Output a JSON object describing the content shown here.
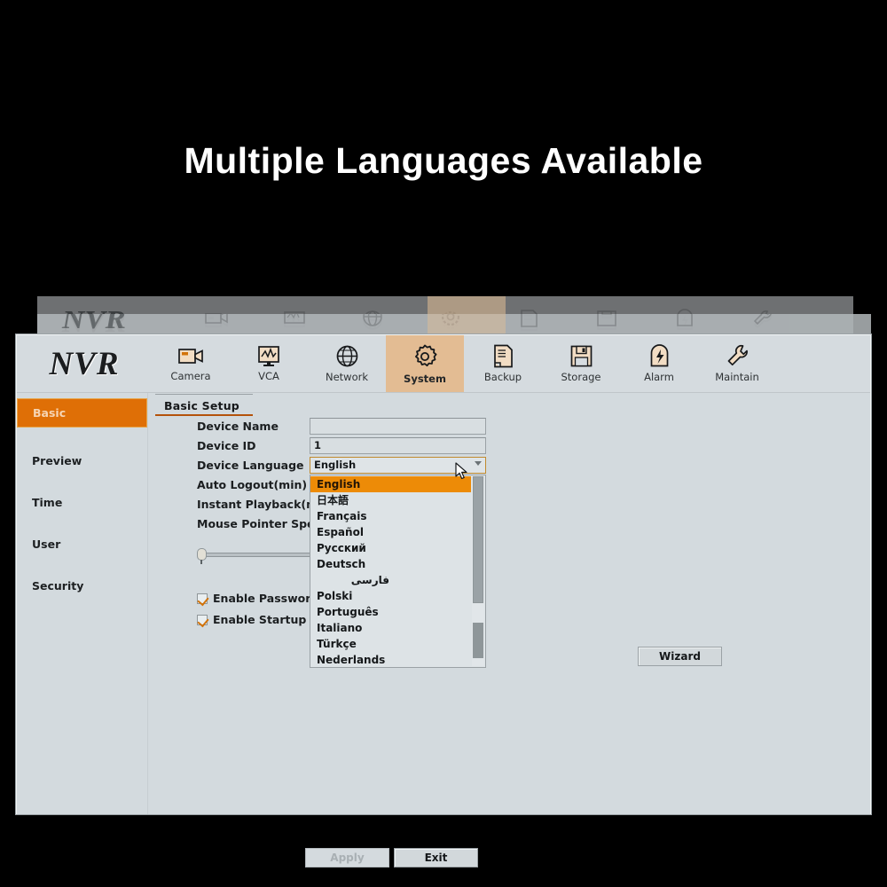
{
  "headline": "Multiple Languages Available",
  "window": {
    "logo": "NVR",
    "toolbar": [
      {
        "label": "Camera",
        "icon": "camera-icon",
        "active": false
      },
      {
        "label": "VCA",
        "icon": "monitor-waveform-icon",
        "active": false
      },
      {
        "label": "Network",
        "icon": "globe-icon",
        "active": false
      },
      {
        "label": "System",
        "icon": "gear-icon",
        "active": true
      },
      {
        "label": "Backup",
        "icon": "document-icon",
        "active": false
      },
      {
        "label": "Storage",
        "icon": "floppy-disk-icon",
        "active": false
      },
      {
        "label": "Alarm",
        "icon": "bell-lightning-icon",
        "active": false
      },
      {
        "label": "Maintain",
        "icon": "wrench-icon",
        "active": false
      }
    ],
    "sidebar": [
      {
        "label": "Basic",
        "active": true
      },
      {
        "label": "Preview",
        "active": false
      },
      {
        "label": "Time",
        "active": false
      },
      {
        "label": "User",
        "active": false
      },
      {
        "label": "Security",
        "active": false
      }
    ],
    "tab": "Basic Setup",
    "form": {
      "device_name_label": "Device Name",
      "device_name_value": "",
      "device_id_label": "Device ID",
      "device_id_value": "1",
      "device_language_label": "Device Language",
      "device_language_value": "English",
      "auto_logout_label": "Auto Logout(min)",
      "instant_playback_label": "Instant Playback(m...",
      "mouse_pointer_speed_label": "Mouse Pointer Speed"
    },
    "language_options": [
      {
        "label": "English",
        "selected": true,
        "rtl": false
      },
      {
        "label": "日本語",
        "selected": false,
        "rtl": false
      },
      {
        "label": "Français",
        "selected": false,
        "rtl": false
      },
      {
        "label": "Español",
        "selected": false,
        "rtl": false
      },
      {
        "label": "Русский",
        "selected": false,
        "rtl": false
      },
      {
        "label": "Deutsch",
        "selected": false,
        "rtl": false
      },
      {
        "label": "فارسی",
        "selected": false,
        "rtl": true
      },
      {
        "label": "Polski",
        "selected": false,
        "rtl": false
      },
      {
        "label": "Português",
        "selected": false,
        "rtl": false
      },
      {
        "label": "Italiano",
        "selected": false,
        "rtl": false
      },
      {
        "label": "Türkçe",
        "selected": false,
        "rtl": false
      },
      {
        "label": "Nederlands",
        "selected": false,
        "rtl": false
      }
    ],
    "checkboxes": [
      {
        "label": "Enable Password Pr",
        "checked": true
      },
      {
        "label": "Enable Startup Wiz.",
        "checked": true
      }
    ],
    "buttons": {
      "wizard": "Wizard",
      "apply": "Apply",
      "exit": "Exit"
    }
  },
  "colors": {
    "accent_orange": "#df6f06",
    "highlight_orange": "#ed8b07",
    "tab_tan": "#e3bc93",
    "panel_bg": "#d3dade",
    "underline": "#b4520b",
    "backdrop": "#000000"
  }
}
